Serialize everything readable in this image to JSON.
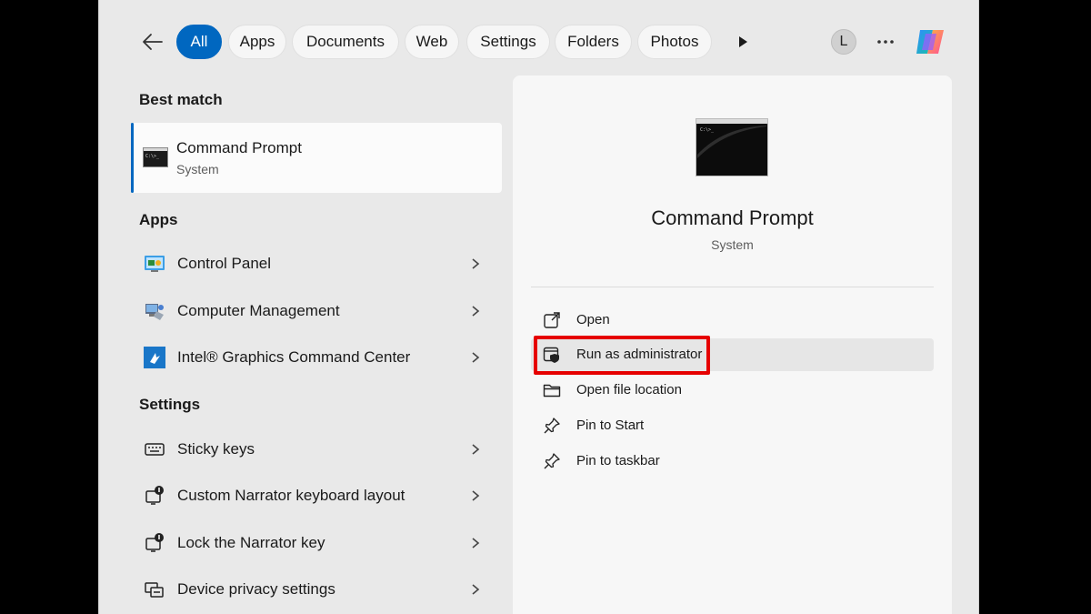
{
  "filters": [
    "All",
    "Apps",
    "Documents",
    "Web",
    "Settings",
    "Folders",
    "Photos"
  ],
  "active_filter": "All",
  "user_initial": "L",
  "best_match": {
    "heading": "Best match",
    "title": "Command Prompt",
    "subtitle": "System",
    "icon": "command-prompt-icon"
  },
  "apps": {
    "heading": "Apps",
    "items": [
      {
        "label": "Control Panel",
        "icon": "control-panel-icon"
      },
      {
        "label": "Computer Management",
        "icon": "computer-management-icon"
      },
      {
        "label": "Intel® Graphics Command Center",
        "icon": "intel-graphics-icon"
      }
    ]
  },
  "settings": {
    "heading": "Settings",
    "items": [
      {
        "label": "Sticky keys",
        "icon": "keyboard-icon"
      },
      {
        "label": "Custom Narrator keyboard layout",
        "icon": "narrator-icon"
      },
      {
        "label": "Lock the Narrator key",
        "icon": "narrator-icon"
      },
      {
        "label": "Device privacy settings",
        "icon": "privacy-icon"
      }
    ]
  },
  "details": {
    "title": "Command Prompt",
    "subtitle": "System",
    "actions": [
      {
        "label": "Open",
        "icon": "open-external-icon"
      },
      {
        "label": "Run as administrator",
        "icon": "shield-window-icon"
      },
      {
        "label": "Open file location",
        "icon": "folder-icon"
      },
      {
        "label": "Pin to Start",
        "icon": "pin-icon"
      },
      {
        "label": "Pin to taskbar",
        "icon": "pin-icon"
      }
    ]
  },
  "colors": {
    "accent": "#0067c0",
    "highlight_box": "#e60000"
  }
}
